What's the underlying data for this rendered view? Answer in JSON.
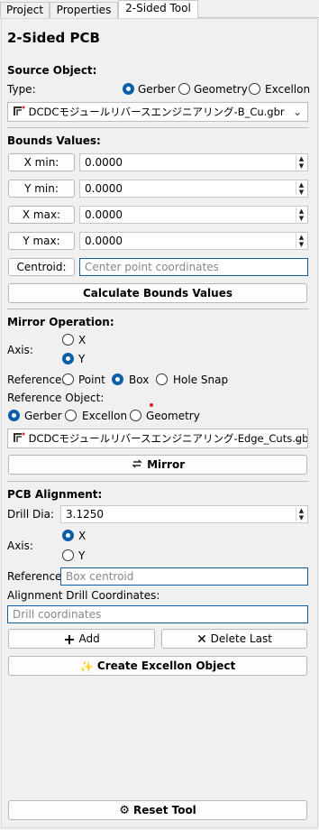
{
  "tabs": [
    "Project",
    "Properties",
    "2-Sided Tool"
  ],
  "title": "2-Sided PCB",
  "source": {
    "heading": "Source Object:",
    "type_label": "Type:",
    "type_options": [
      "Gerber",
      "Geometry",
      "Excellon"
    ],
    "selected_type": "Gerber",
    "object": "DCDCモジュールリバースエンジニアリング-B_Cu.gbr"
  },
  "bounds": {
    "heading": "Bounds Values:",
    "x_min_label": "X min:",
    "x_min": "0.0000",
    "y_min_label": "Y min:",
    "y_min": "0.0000",
    "x_max_label": "X max:",
    "x_max": "0.0000",
    "y_max_label": "Y max:",
    "y_max": "0.0000",
    "centroid_label": "Centroid:",
    "centroid_placeholder": "Center point coordinates",
    "calc_button": "Calculate Bounds Values"
  },
  "mirror": {
    "heading": "Mirror Operation:",
    "axis_label": "Axis:",
    "axis_options": [
      "X",
      "Y"
    ],
    "axis_selected": "Y",
    "reference_label": "Reference:",
    "reference_options": [
      "Point",
      "Box",
      "Hole Snap"
    ],
    "reference_selected": "Box",
    "ref_object_label": "Reference Object:",
    "ref_object_options": [
      "Gerber",
      "Excellon",
      "Geometry"
    ],
    "ref_object_selected": "Gerber",
    "object": "DCDCモジュールリバースエンジニアリング-Edge_Cuts.gbr",
    "button": "Mirror"
  },
  "alignment": {
    "heading": "PCB Alignment:",
    "drill_dia_label": "Drill Dia:",
    "drill_dia": "3.1250",
    "axis_label": "Axis:",
    "axis_options": [
      "X",
      "Y"
    ],
    "axis_selected": "X",
    "reference_label": "Reference:",
    "reference_placeholder": "Box centroid",
    "coords_label": "Alignment Drill Coordinates:",
    "coords_placeholder": "Drill coordinates",
    "add_button": "Add",
    "delete_button": "Delete Last",
    "create_button": "Create Excellon Object"
  },
  "reset_button": "Reset Tool",
  "colors": {
    "accent": "#0b5ea8",
    "background": "#f0f0f0"
  }
}
